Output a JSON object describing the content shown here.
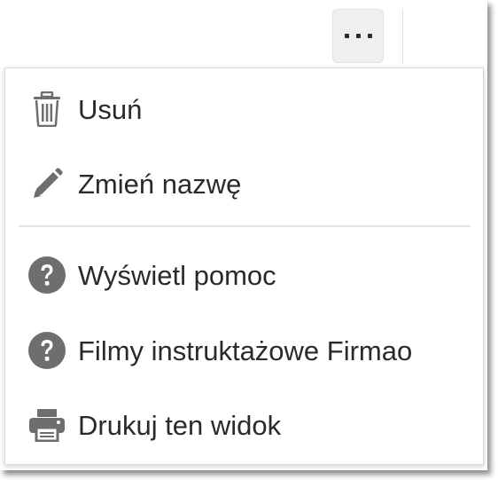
{
  "toolbar": {
    "more_icon": "ellipsis-horizontal-icon"
  },
  "menu": {
    "items": [
      {
        "label": "Usuń",
        "icon": "trash-icon"
      },
      {
        "label": "Zmień nazwę",
        "icon": "pencil-icon"
      },
      {
        "label": "Wyświetl pomoc",
        "icon": "question-circle-icon"
      },
      {
        "label": "Filmy instruktażowe Firmao",
        "icon": "question-circle-icon"
      },
      {
        "label": "Drukuj ten widok",
        "icon": "printer-icon"
      }
    ]
  },
  "colors": {
    "icon": "#6e6e6e",
    "text": "#2a2a2a",
    "button_bg": "#efefef"
  }
}
